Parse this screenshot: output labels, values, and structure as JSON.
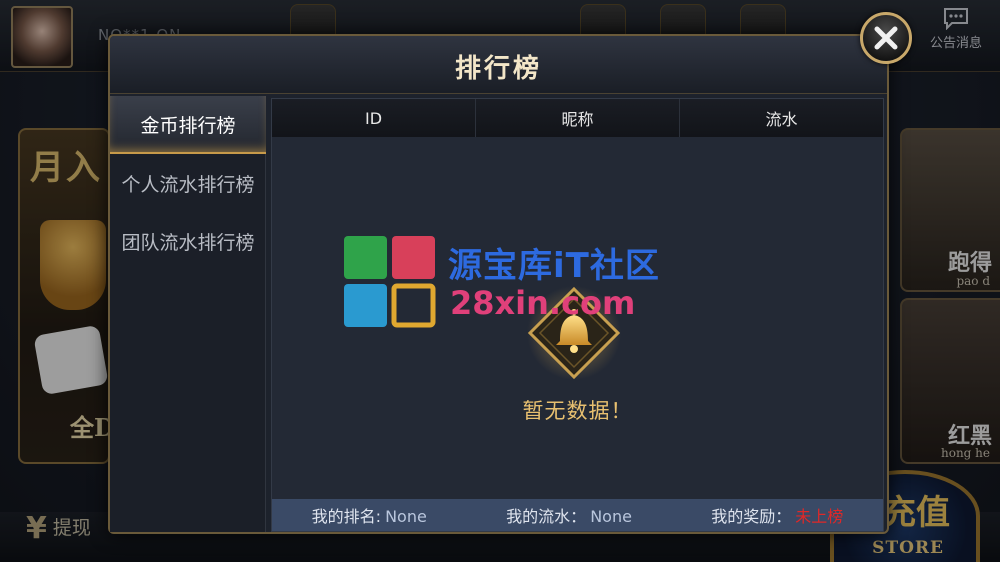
{
  "background": {
    "username": "NO**1 ON",
    "notice_label": "公告消息",
    "left_card": {
      "title": "月入",
      "subtitle": "全D"
    },
    "right_card_1": {
      "title": "跑得",
      "subtitle": "pao d"
    },
    "right_card_2": {
      "title": "红黑",
      "subtitle": "hong he"
    },
    "bottom": {
      "withdraw_label": "提现",
      "store_big": "充值",
      "store_label": "STORE"
    }
  },
  "modal": {
    "title": "排行榜",
    "tabs": [
      {
        "label": "金币排行榜",
        "active": true
      },
      {
        "label": "个人流水排行榜",
        "active": false
      },
      {
        "label": "团队流水排行榜",
        "active": false
      }
    ],
    "table": {
      "columns": [
        "ID",
        "昵称",
        "流水"
      ],
      "rows": []
    },
    "empty_text": "暂无数据！",
    "footer": {
      "rank_label": "我的排名:",
      "rank_value": "None",
      "flow_label": "我的流水：",
      "flow_value": "None",
      "reward_label": "我的奖励：",
      "reward_value": "未上榜"
    }
  },
  "watermark": {
    "line1": "源宝库iT社区",
    "line2": "28xin.com"
  },
  "colors": {
    "accent_gold": "#c79a4a",
    "empty_text": "#e8c070",
    "footer_bg": "#3a4a66",
    "reward_red": "#e02828"
  }
}
